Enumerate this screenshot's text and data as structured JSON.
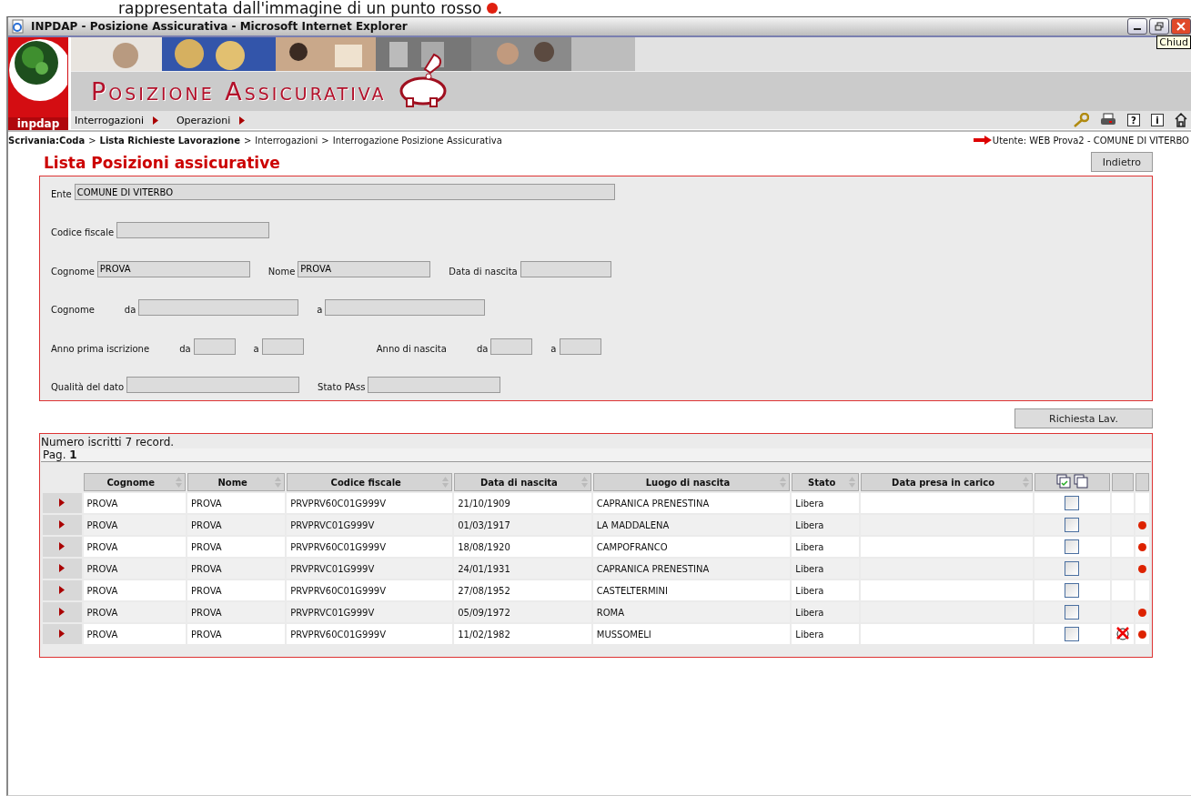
{
  "caption": {
    "text": "rappresentata dall'immagine di un punto rosso",
    "end": "."
  },
  "window": {
    "title": "INPDAP - Posizione Assicurativa - Microsoft Internet Explorer",
    "tooltip": "Chiud"
  },
  "banner": {
    "logo": "inpdap",
    "title": "Posizione Assicurativa"
  },
  "menu": [
    {
      "label": "Interrogazioni"
    },
    {
      "label": "Operazioni"
    }
  ],
  "tools": {
    "help": "?",
    "info": "i"
  },
  "breadcrumb": [
    {
      "label": "Scrivania:Coda",
      "bold": true
    },
    {
      "separator": ">",
      "label": "Lista Richieste Lavorazione",
      "bold": true
    },
    {
      "separator": ">",
      "label": "Interrogazioni",
      "bold": false
    },
    {
      "separator": ">",
      "label": "Interrogazione Posizione Assicurativa",
      "bold": false
    }
  ],
  "user": "Utente: WEB Prova2 - COMUNE DI VITERBO",
  "page_title": "Lista Posizioni assicurative",
  "back_button": "Indietro",
  "form": [
    {
      "fields": [
        {
          "label": "Ente",
          "value": "COMUNE DI VITERBO"
        }
      ]
    },
    {
      "fields": [
        {
          "label": "Codice fiscale"
        }
      ]
    },
    {
      "fields": [
        {
          "label": "Cognome",
          "value": "PROVA"
        },
        {
          "label": "Nome",
          "value": "PROVA"
        },
        {
          "label": "Data di nascita"
        }
      ]
    },
    {
      "fields": [
        {
          "label": "Cognome",
          "sub": "da"
        },
        {
          "label": "a"
        }
      ]
    },
    {
      "fields": [
        {
          "label": "Anno prima iscrizione",
          "sub": "da"
        },
        {
          "label": "a"
        },
        {
          "label": "Anno di nascita",
          "sub": "da"
        },
        {
          "label": "a"
        }
      ]
    },
    {
      "fields": [
        {
          "label": "Qualità del dato"
        },
        {
          "label": "Stato PAss"
        }
      ]
    }
  ],
  "request_button": "Richiesta Lav.",
  "results": {
    "count": "Numero iscritti 7 record.",
    "page_label": "Pag.",
    "page": "1"
  },
  "table": {
    "columns": [
      "Cognome",
      "Nome",
      "Codice fiscale",
      "Data di nascita",
      "Luogo di nascita",
      "Stato",
      "Data presa in carico"
    ],
    "rows": [
      {
        "cells": [
          "PROVA",
          "PROVA",
          "PRVPRV60C01G999V",
          "21/10/1909",
          "CAPRANICA PRENESTINA",
          "Libera",
          ""
        ],
        "checked": false,
        "blocked": false,
        "dot": false
      },
      {
        "cells": [
          "PROVA",
          "PROVA",
          "PRVPRVC01G999V",
          "01/03/1917",
          "LA MADDALENA",
          "Libera",
          ""
        ],
        "checked": false,
        "blocked": false,
        "dot": true
      },
      {
        "cells": [
          "PROVA",
          "PROVA",
          "PRVPRV60C01G999V",
          "18/08/1920",
          "CAMPOFRANCO",
          "Libera",
          ""
        ],
        "checked": false,
        "blocked": false,
        "dot": true
      },
      {
        "cells": [
          "PROVA",
          "PROVA",
          "PRVPRVC01G999V",
          "24/01/1931",
          "CAPRANICA PRENESTINA",
          "Libera",
          ""
        ],
        "checked": false,
        "blocked": false,
        "dot": true
      },
      {
        "cells": [
          "PROVA",
          "PROVA",
          "PRVPRV60C01G999V",
          "27/08/1952",
          "CASTELTERMINI",
          "Libera",
          ""
        ],
        "checked": false,
        "blocked": false,
        "dot": false
      },
      {
        "cells": [
          "PROVA",
          "PROVA",
          "PRVPRVC01G999V",
          "05/09/1972",
          "ROMA",
          "Libera",
          ""
        ],
        "checked": false,
        "blocked": false,
        "dot": true
      },
      {
        "cells": [
          "PROVA",
          "PROVA",
          "PRVPRV60C01G999V",
          "11/02/1982",
          "MUSSOMELI",
          "Libera",
          ""
        ],
        "checked": false,
        "blocked": true,
        "dot": true
      }
    ]
  }
}
